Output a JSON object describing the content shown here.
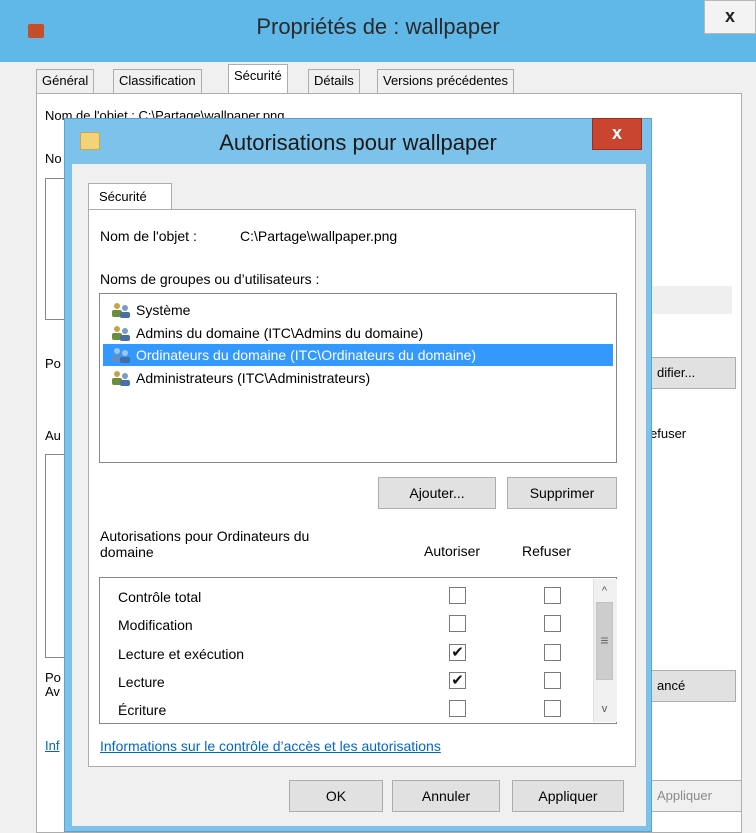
{
  "back_window": {
    "title": "Propriétés de : wallpaper",
    "close_glyph": "x",
    "tabs": [
      "Général",
      "Classification",
      "Sécurité",
      "Détails",
      "Versions précédentes"
    ],
    "object_name_line": "Nom de l'objet :    C:\\Partage\\wallpaper.png",
    "side_labels": {
      "no": "No",
      "po": "Po",
      "au": "Au",
      "po2": "Po",
      "av": "Av",
      "inf": "Inf"
    },
    "modify_button": "difier...",
    "refuse_fragment": "efuser",
    "advanced_button": "ancé",
    "apply_button": "Appliquer"
  },
  "dialog": {
    "title": "Autorisations pour wallpaper",
    "close_glyph": "x",
    "tab": "Sécurité",
    "object_name_label": "Nom de l'objet :",
    "object_name_value": "C:\\Partage\\wallpaper.png",
    "groups_label": "Noms de groupes ou d’utilisateurs :",
    "groups": [
      {
        "label": "Système",
        "selected": false
      },
      {
        "label": "Admins du domaine (ITC\\Admins du domaine)",
        "selected": false
      },
      {
        "label": "Ordinateurs du domaine (ITC\\Ordinateurs du domaine)",
        "selected": true
      },
      {
        "label": "Administrateurs (ITC\\Administrateurs)",
        "selected": false
      }
    ],
    "add_button": "Ajouter...",
    "remove_button": "Supprimer",
    "permissions_label_line1": "Autorisations pour Ordinateurs du",
    "permissions_label_line2": "domaine",
    "allow_header": "Autoriser",
    "deny_header": "Refuser",
    "permissions": [
      {
        "name": "Contrôle total",
        "allow": false,
        "deny": false
      },
      {
        "name": "Modification",
        "allow": false,
        "deny": false
      },
      {
        "name": "Lecture et exécution",
        "allow": true,
        "deny": false
      },
      {
        "name": "Lecture",
        "allow": true,
        "deny": false
      },
      {
        "name": "Écriture",
        "allow": false,
        "deny": false
      }
    ],
    "info_link": "Informations sur le contrôle d’accès et les autorisations",
    "ok_button": "OK",
    "cancel_button": "Annuler",
    "apply_button": "Appliquer"
  },
  "icons": {
    "check_glyph": "✔",
    "scroll_up": "^",
    "scroll_down": "v",
    "thumb_grip": "≡"
  },
  "colors": {
    "titlebar": "#60b8e8",
    "dialog_frame": "#7cc2ea",
    "close_red": "#c9452f",
    "selection": "#3399ff",
    "link": "#0066cc"
  }
}
